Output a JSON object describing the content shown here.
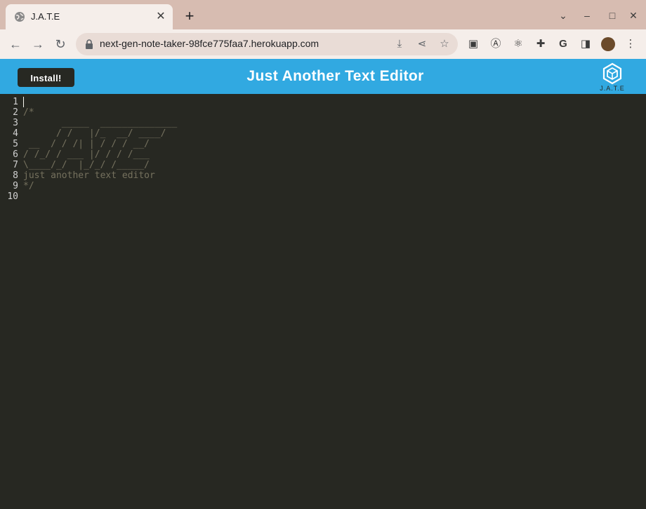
{
  "browser": {
    "tab": {
      "title": "J.A.T.E",
      "favicon": "globe-icon"
    },
    "url": "next-gen-note-taker-98fce775faa7.herokuapp.com"
  },
  "app": {
    "install_label": "Install!",
    "title": "Just Another Text Editor",
    "logo_text": "J.A.T.E",
    "header_color": "#31a9e1",
    "editor_bg": "#272822"
  },
  "editor": {
    "lines": [
      {
        "n": "1",
        "text": ""
      },
      {
        "n": "2",
        "text": "/*"
      },
      {
        "n": "3",
        "text": "       _____  ______________"
      },
      {
        "n": "4",
        "text": "      / /   |/_  __/ ____/"
      },
      {
        "n": "5",
        "text": " __  / / /| | / / / __/"
      },
      {
        "n": "6",
        "text": "/ /_/ / ___ |/ / / /___"
      },
      {
        "n": "7",
        "text": "\\____/_/  |_/_/ /_____/"
      },
      {
        "n": "8",
        "text": "just another text editor"
      },
      {
        "n": "9",
        "text": "*/"
      },
      {
        "n": "10",
        "text": ""
      }
    ]
  }
}
